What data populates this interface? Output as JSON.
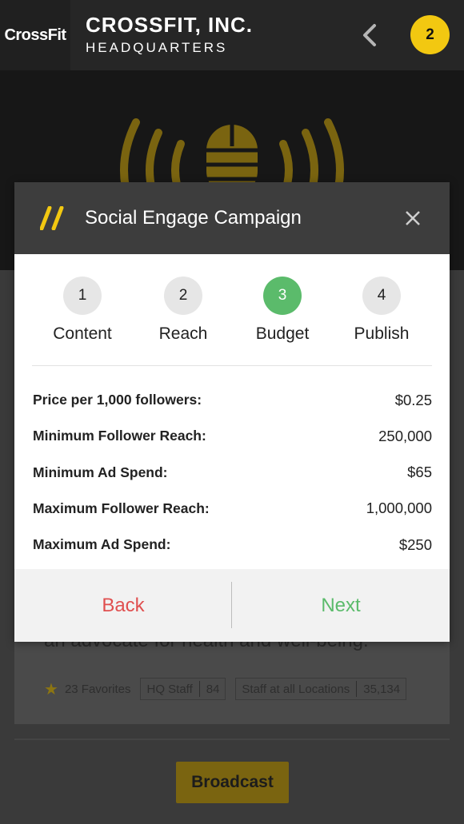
{
  "app": {
    "logo_text": "CrossFit",
    "title": "CROSSFIT, INC.",
    "subtitle": "HEADQUARTERS",
    "notification_count": "2",
    "back_icon": "chevron-left-icon",
    "hero_icon": "broadcast-microphone-icon"
  },
  "content": {
    "description": "an advocate for health and well-being.",
    "favorites": "23 Favorites",
    "hq_staff_label": "HQ Staff",
    "hq_staff_count": "84",
    "staff_all_label": "Staff at all Locations",
    "staff_all_count": "35,134",
    "broadcast_label": "Broadcast"
  },
  "modal": {
    "title": "Social Engage Campaign",
    "steps": [
      {
        "number": "1",
        "label": "Content",
        "active": false
      },
      {
        "number": "2",
        "label": "Reach",
        "active": false
      },
      {
        "number": "3",
        "label": "Budget",
        "active": true
      },
      {
        "number": "4",
        "label": "Publish",
        "active": false
      }
    ],
    "details": [
      {
        "label": "Price per 1,000 followers:",
        "value": "$0.25"
      },
      {
        "label": "Minimum Follower Reach:",
        "value": "250,000"
      },
      {
        "label": "Minimum Ad Spend:",
        "value": "$65"
      },
      {
        "label": "Maximum Follower Reach:",
        "value": "1,000,000"
      },
      {
        "label": "Maximum Ad Spend:",
        "value": "$250"
      }
    ],
    "back_label": "Back",
    "next_label": "Next"
  },
  "colors": {
    "accent_yellow": "#f2c811",
    "active_step_green": "#5bbb6b",
    "back_red": "#e04f4f",
    "next_green": "#5bbb6b",
    "header_dark": "#3d3d3d"
  }
}
